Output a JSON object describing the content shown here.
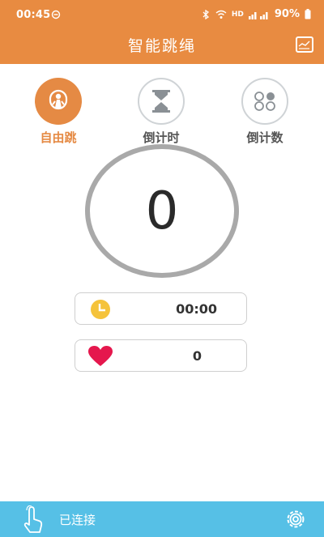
{
  "status": {
    "time": "00:45",
    "net_badge": "HD",
    "battery": "90%"
  },
  "header": {
    "title": "智能跳绳"
  },
  "modes": [
    {
      "label": "自由跳",
      "icon": "person-jumping-icon",
      "active": true
    },
    {
      "label": "倒计时",
      "icon": "hourglass-icon",
      "active": false
    },
    {
      "label": "倒计数",
      "icon": "grid-circles-icon",
      "active": false
    }
  ],
  "counter": {
    "value": "0"
  },
  "timer": {
    "value": "00:00",
    "icon": "clock-icon"
  },
  "heart": {
    "value": "0",
    "icon": "heart-icon"
  },
  "bottom": {
    "status": "已连接"
  },
  "colors": {
    "header": "#e88b41",
    "active": "#e58a44",
    "bottom": "#56c0e6",
    "clock": "#f5c33b",
    "heart": "#e5174d"
  }
}
